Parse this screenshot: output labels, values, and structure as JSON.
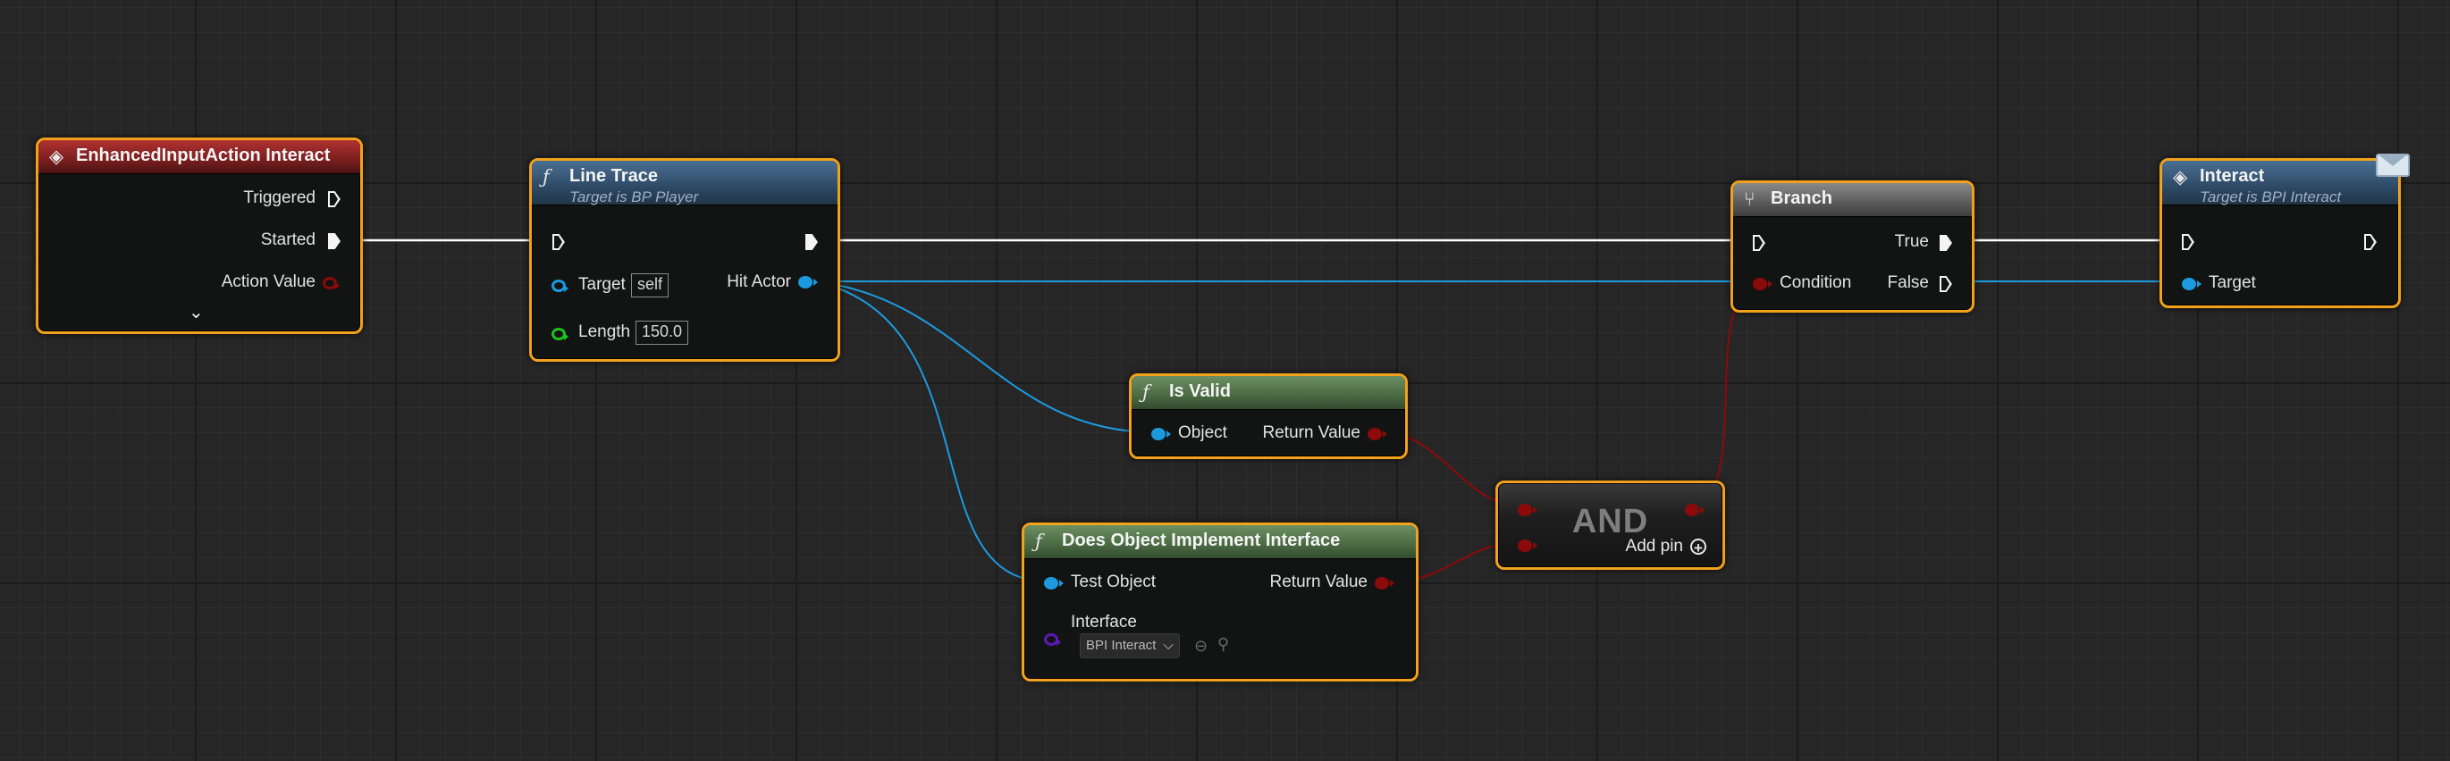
{
  "nodes": {
    "input_action": {
      "title": "EnhancedInputAction Interact",
      "pins": {
        "triggered": "Triggered",
        "started": "Started",
        "action_value": "Action Value"
      },
      "expand_icon": "chevron-down-icon"
    },
    "line_trace": {
      "title": "Line Trace",
      "subtitle": "Target is BP Player",
      "pins": {
        "target": "Target",
        "target_value": "self",
        "length": "Length",
        "length_value": "150.0",
        "hit_actor": "Hit Actor"
      }
    },
    "is_valid": {
      "title": "Is Valid",
      "pins": {
        "object": "Object",
        "return_value": "Return Value"
      }
    },
    "does_implement": {
      "title": "Does Object Implement Interface",
      "pins": {
        "test_object": "Test Object",
        "return_value": "Return Value",
        "interface": "Interface",
        "interface_value": "BPI Interact"
      }
    },
    "and": {
      "title": "AND",
      "add_pin": "Add pin"
    },
    "branch": {
      "title": "Branch",
      "pins": {
        "condition": "Condition",
        "true": "True",
        "false": "False"
      }
    },
    "interact": {
      "title": "Interact",
      "subtitle": "Target is BPI Interact",
      "pins": {
        "target": "Target"
      },
      "badge_icon": "envelope-icon"
    }
  },
  "colors": {
    "selection_outline": "#f2a21a",
    "exec_wire": "#ffffff",
    "object_wire": "#1c9ae0",
    "bool_wire": "#8c0a0a",
    "float_pin": "#1ec21e",
    "interface_pin": "#5a18b8"
  }
}
